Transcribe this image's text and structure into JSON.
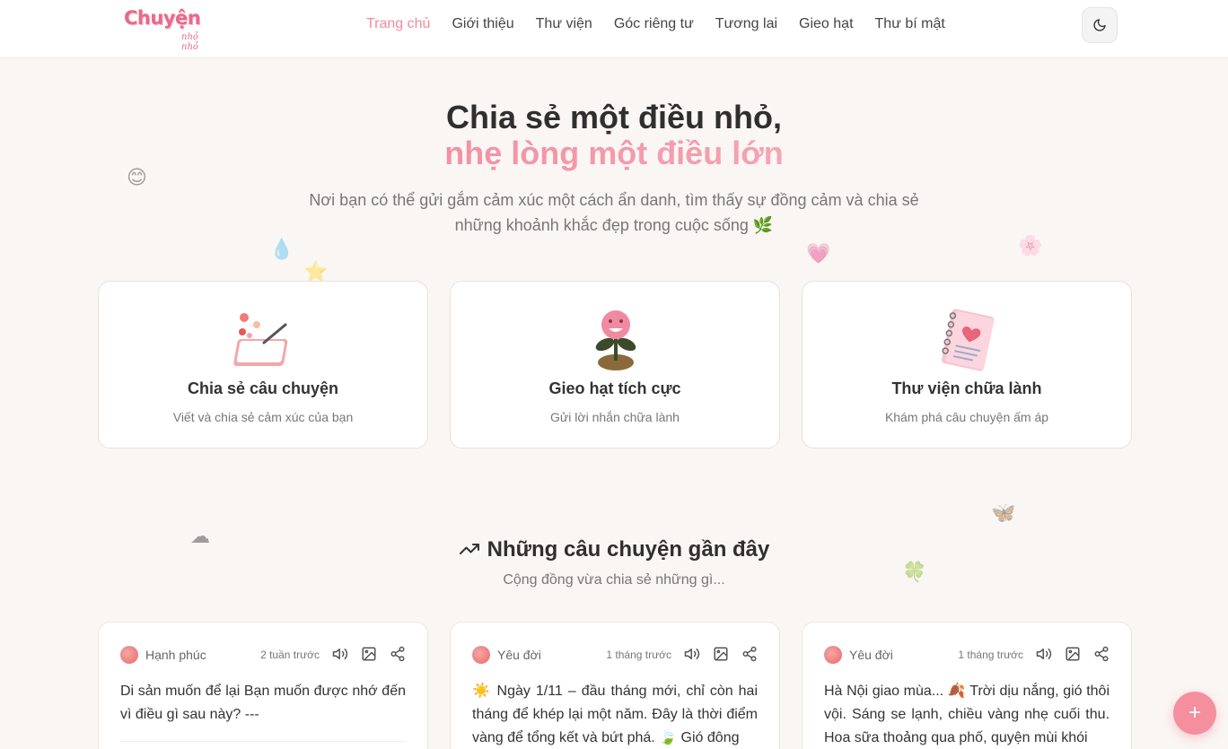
{
  "logo": {
    "main": "Chuyện",
    "sub": "nhỏ nhỏ"
  },
  "nav": [
    {
      "label": "Trang chủ",
      "active": true
    },
    {
      "label": "Giới thiệu"
    },
    {
      "label": "Thư viện"
    },
    {
      "label": "Góc riêng tư"
    },
    {
      "label": "Tương lai"
    },
    {
      "label": "Gieo hạt"
    },
    {
      "label": "Thư bí mật"
    }
  ],
  "theme_toggle": {
    "icon": "moon-icon"
  },
  "hero": {
    "title_line1": "Chia sẻ một điều nhỏ,",
    "title_line2": "nhẹ lòng một điều lớn",
    "description": "Nơi bạn có thể gửi gắm cảm xúc một cách ẩn danh, tìm thấy sự đồng cảm và chia sẻ những khoảnh khắc đẹp trong cuộc sống 🌿"
  },
  "features": [
    {
      "title": "Chia sẻ câu chuyện",
      "subtitle": "Viết và chia sẻ cảm xúc của bạn",
      "icon": "tablet-drawing-icon"
    },
    {
      "title": "Gieo hạt tích cực",
      "subtitle": "Gửi lời nhắn chữa lành",
      "icon": "sprout-icon"
    },
    {
      "title": "Thư viện chữa lành",
      "subtitle": "Khám phá câu chuyện ấm áp",
      "icon": "notebook-heart-icon"
    }
  ],
  "recent": {
    "title": "Những câu chuyện gần đây",
    "subtitle": "Cộng đồng vừa chia sẻ những gì...",
    "stories": [
      {
        "mood": "Hạnh phúc",
        "time": "2 tuần trước",
        "body": "Di sản muốn để lại Bạn muốn được nhớ đến vì điều gì sau này? ---"
      },
      {
        "mood": "Yêu đời",
        "time": "1 tháng trước",
        "body": "☀️ Ngày 1/11 – đầu tháng mới, chỉ còn hai tháng để khép lại một năm. Đây là thời điểm vàng để tổng kết và bứt phá. 🍃 Gió đông"
      },
      {
        "mood": "Yêu đời",
        "time": "1 tháng trước",
        "body": "Hà Nội giao mùa... 🍂 Trời dịu nắng, gió thôi vội. Sáng se lạnh, chiều vàng nhẹ cuối thu. Hoa sữa thoảng qua phố, quyện mùi khói"
      }
    ]
  },
  "fab": {
    "label": "+"
  },
  "colors": {
    "accent": "#f48aa0",
    "background": "#faf6f3"
  }
}
